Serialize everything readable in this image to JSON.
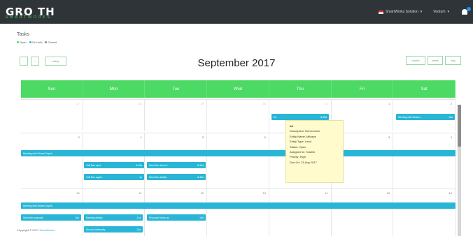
{
  "header": {
    "logo": "GRO TH",
    "logo_sub": "SMARTWORKS",
    "company": "SmartWorks Solution",
    "user": "Vedram",
    "company_caret": "▾",
    "user_caret": "▾"
  },
  "page": {
    "title": "Tasks",
    "legend": [
      {
        "label": "Open",
        "color": "#4cd964"
      },
      {
        "label": "On Hold",
        "color": "#29b6d6"
      },
      {
        "label": "Closed",
        "color": "#8c8c8c"
      }
    ]
  },
  "toolbar": {
    "prev": "‹",
    "next": "›",
    "today": "today",
    "month": "month",
    "week": "week",
    "day": "day"
  },
  "calendar": {
    "title": "September 2017",
    "days": [
      "Sun",
      "Mon",
      "Tue",
      "Wed",
      "Thu",
      "Fri",
      "Sat"
    ],
    "weeks": [
      {
        "nums": [
          "27",
          "28",
          "29",
          "30",
          "31",
          "1",
          "2"
        ]
      },
      {
        "nums": [
          "3",
          "4",
          "5",
          "6",
          "7",
          "8",
          "9"
        ]
      },
      {
        "nums": [
          "10",
          "11",
          "12",
          "13",
          "14",
          "15",
          "16"
        ]
      }
    ],
    "events": [
      {
        "label": "dd",
        "time": "8:49a"
      },
      {
        "label": "Meeting with Deans...",
        "time": "10a"
      },
      {
        "label": "Meeting with Deane Dupris",
        "time": ""
      },
      {
        "label": "Call Ben spot",
        "time": "8:49a"
      },
      {
        "label": "Send the demo li...",
        "time": "8:49a"
      },
      {
        "label": "Call Ben again",
        "time": "1p"
      },
      {
        "label": "Send the details",
        "time": "8:49a"
      },
      {
        "label": "Meeting with Deane Dupris",
        "time": ""
      },
      {
        "label": "Send the proposal",
        "time": "10a"
      },
      {
        "label": "Meeting details",
        "time": "11a"
      },
      {
        "label": "Proposal follow up",
        "time": "10a"
      },
      {
        "label": "Discuss internally",
        "time": "10a"
      }
    ]
  },
  "tooltip": {
    "title": "dd",
    "description": "Description: Demo team",
    "entity_name": "Entity Name: Mitasys",
    "entity_type": "Entity Type: Lead",
    "status": "Status: Open",
    "assigned": "Assigned to: Yaarish",
    "priority": "Priority: High",
    "due": "Due On: 31 Aug 2017"
  },
  "footer": {
    "copyright": "Copyright © 2017",
    "link": "SmartWorks"
  }
}
